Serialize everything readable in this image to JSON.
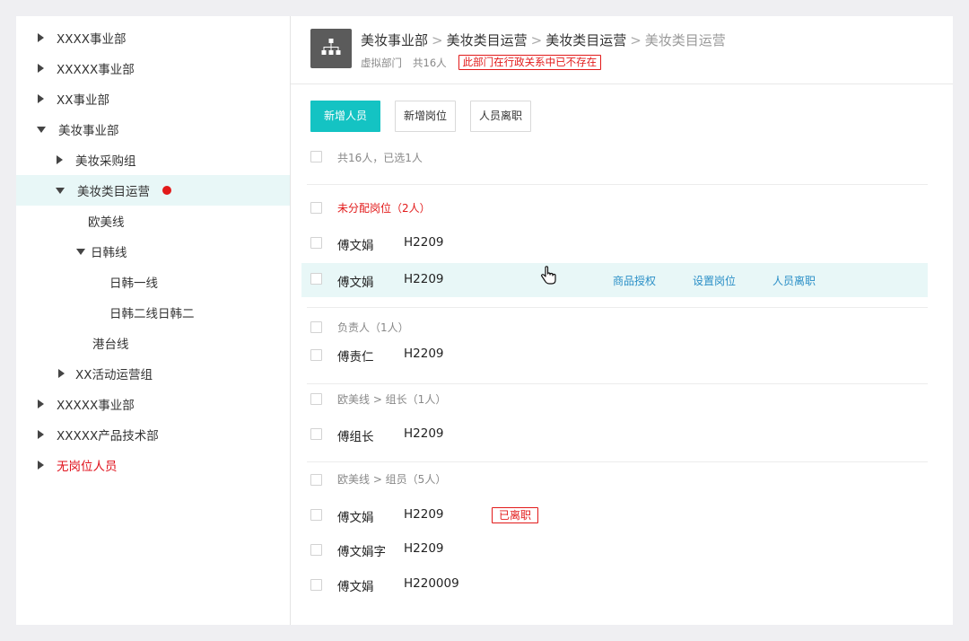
{
  "sidebar": {
    "items": [
      {
        "label": "XXXX事业部"
      },
      {
        "label": "XXXXX事业部"
      },
      {
        "label": "XX事业部"
      },
      {
        "label": "美妆事业部"
      },
      {
        "label": "美妆采购组"
      },
      {
        "label": "美妆类目运营"
      },
      {
        "label": "欧美线"
      },
      {
        "label": "日韩线"
      },
      {
        "label": "日韩一线"
      },
      {
        "label": "日韩二线日韩二"
      },
      {
        "label": "港台线"
      },
      {
        "label": "XX活动运营组"
      },
      {
        "label": "XXXXX事业部"
      },
      {
        "label": "XXXXX产品技术部"
      },
      {
        "label": "无岗位人员"
      }
    ]
  },
  "header": {
    "breadcrumb": [
      "美妆事业部",
      "美妆类目运营",
      "美妆类目运营",
      "美妆类目运营"
    ],
    "separator": ">",
    "dept_type": "虚拟部门",
    "count": "共16人",
    "warning": "此部门在行政关系中已不存在"
  },
  "toolbar": {
    "add_member": "新增人员",
    "add_position": "新增岗位",
    "resign": "人员离职"
  },
  "selection_summary": "共16人，已选1人",
  "groups": {
    "unassigned": {
      "title": "未分配岗位（2人）",
      "members": [
        {
          "name": "傅文娟",
          "code": "H2209"
        },
        {
          "name": "傅文娟",
          "code": "H2209"
        }
      ],
      "row_actions": [
        "商品授权",
        "设置岗位",
        "人员离职"
      ]
    },
    "leader": {
      "title": "负责人（1人）",
      "members": [
        {
          "name": "傅责仁",
          "code": "H2209"
        }
      ]
    },
    "team_leader": {
      "title": "欧美线 > 组长（1人）",
      "members": [
        {
          "name": "傅组长",
          "code": "H2209"
        }
      ]
    },
    "team_members": {
      "title": "欧美线 > 组员（5人）",
      "members": [
        {
          "name": "傅文娟",
          "code": "H2209",
          "tag": "已离职"
        },
        {
          "name": "傅文娟字",
          "code": "H2209"
        },
        {
          "name": "傅文娟",
          "code": "H220009"
        }
      ]
    }
  },
  "colors": {
    "accent": "#14c3c3",
    "danger": "#e21a1a",
    "link": "#2a8fc7",
    "selected_bg": "#e8f7f7"
  },
  "icons": {
    "dept": "org-chart-icon",
    "cursor": "hand-pointer-icon"
  }
}
